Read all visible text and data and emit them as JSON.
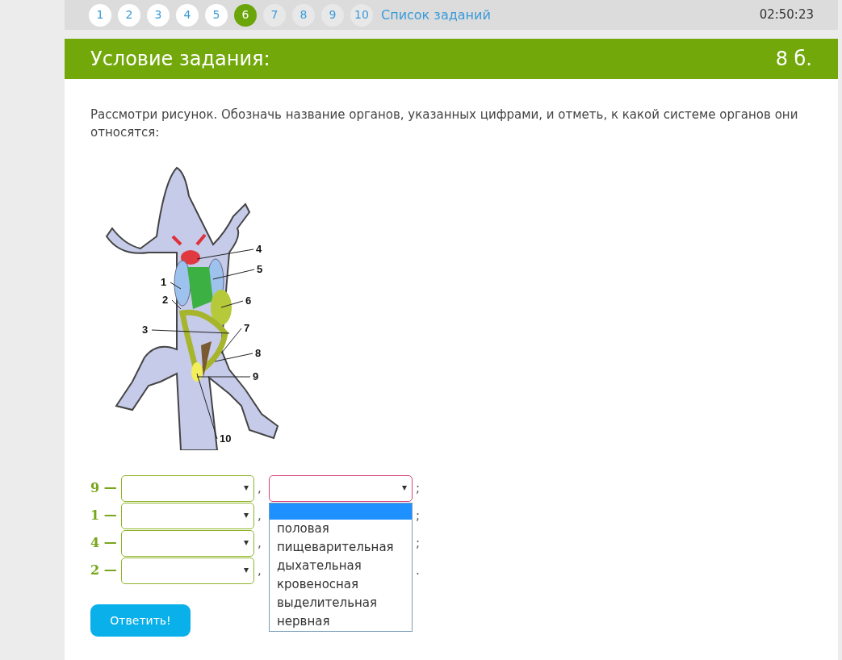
{
  "pagination": [
    {
      "label": "1",
      "visited": true,
      "selected": false
    },
    {
      "label": "2",
      "visited": true,
      "selected": false
    },
    {
      "label": "3",
      "visited": true,
      "selected": false
    },
    {
      "label": "4",
      "visited": true,
      "selected": false
    },
    {
      "label": "5",
      "visited": true,
      "selected": false
    },
    {
      "label": "6",
      "visited": true,
      "selected": true
    },
    {
      "label": "7",
      "visited": false,
      "selected": false
    },
    {
      "label": "8",
      "visited": false,
      "selected": false
    },
    {
      "label": "9",
      "visited": false,
      "selected": false
    },
    {
      "label": "10",
      "visited": false,
      "selected": false
    }
  ],
  "task_list_link": "Список заданий",
  "timer": "02:50:23",
  "task": {
    "title": "Условие задания:",
    "points": "8 б.",
    "question": "Рассмотри рисунок. Обозначь название органов, указанных цифрами, и отметь, к какой системе органов они относятся:",
    "figure": {
      "labels": [
        "4",
        "5",
        "1",
        "6",
        "2",
        "3",
        "7",
        "8",
        "9",
        "10"
      ]
    },
    "answers": [
      {
        "number": "9 —",
        "comma": ",",
        "end": ";",
        "dropdown": {
          "blank_highlighted": true,
          "options": [
            "половая",
            "пищеварительная",
            "дыхательная",
            "кровеносная",
            "выделительная",
            "нервная"
          ]
        }
      },
      {
        "number": "1 —",
        "comma": ",",
        "end": ";"
      },
      {
        "number": "4 —",
        "comma": ",",
        "end": ";"
      },
      {
        "number": "2 —",
        "comma": ",",
        "end": "."
      }
    ],
    "submit": "Ответить!"
  }
}
